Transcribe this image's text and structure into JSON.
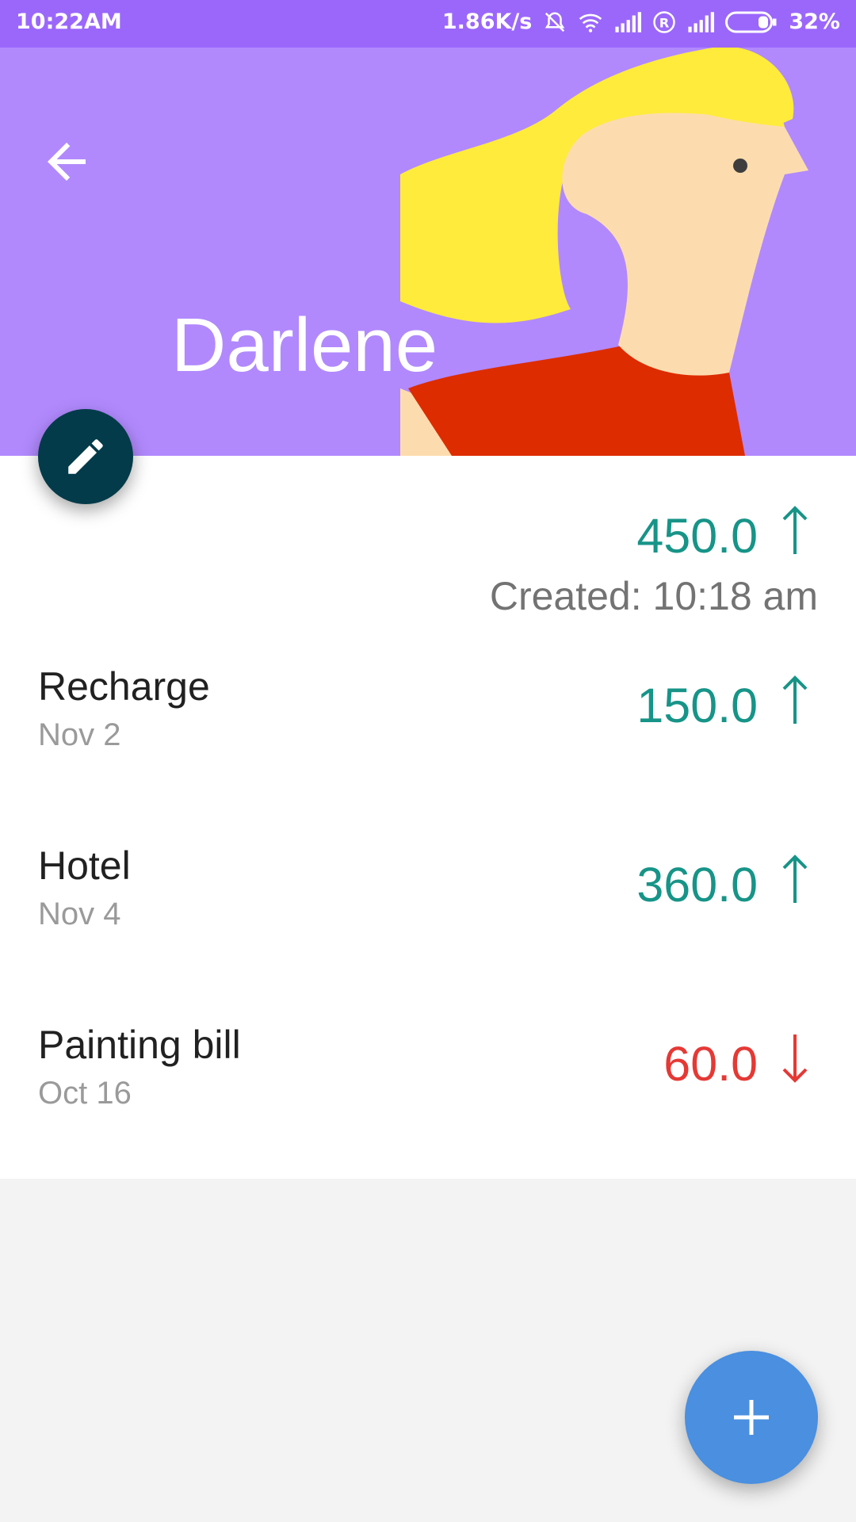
{
  "status_bar": {
    "time": "10:22AM",
    "net_speed": "1.86K/s",
    "battery": "32%",
    "icons": [
      "mute-icon",
      "wifi-icon",
      "signal-icon",
      "roaming-icon",
      "signal-icon",
      "battery-icon"
    ]
  },
  "header": {
    "name": "Darlene",
    "back_icon": "arrow-left-icon",
    "edit_icon": "pencil-icon",
    "background_color": "#b189fd"
  },
  "summary": {
    "balance": "450.0",
    "direction": "up",
    "created": "Created: 10:18 am"
  },
  "transactions": [
    {
      "title": "Recharge",
      "date": "Nov 2",
      "amount": "150.0",
      "direction": "up"
    },
    {
      "title": "Hotel",
      "date": "Nov 4",
      "amount": "360.0",
      "direction": "up"
    },
    {
      "title": "Painting bill",
      "date": "Oct 16",
      "amount": "60.0",
      "direction": "down"
    }
  ],
  "colors": {
    "status_bar": "#9b67fb",
    "positive": "#179488",
    "negative": "#e53935",
    "edit_fab": "#033b4a",
    "add_fab": "#4a8fe0"
  },
  "add_icon": "plus-icon"
}
